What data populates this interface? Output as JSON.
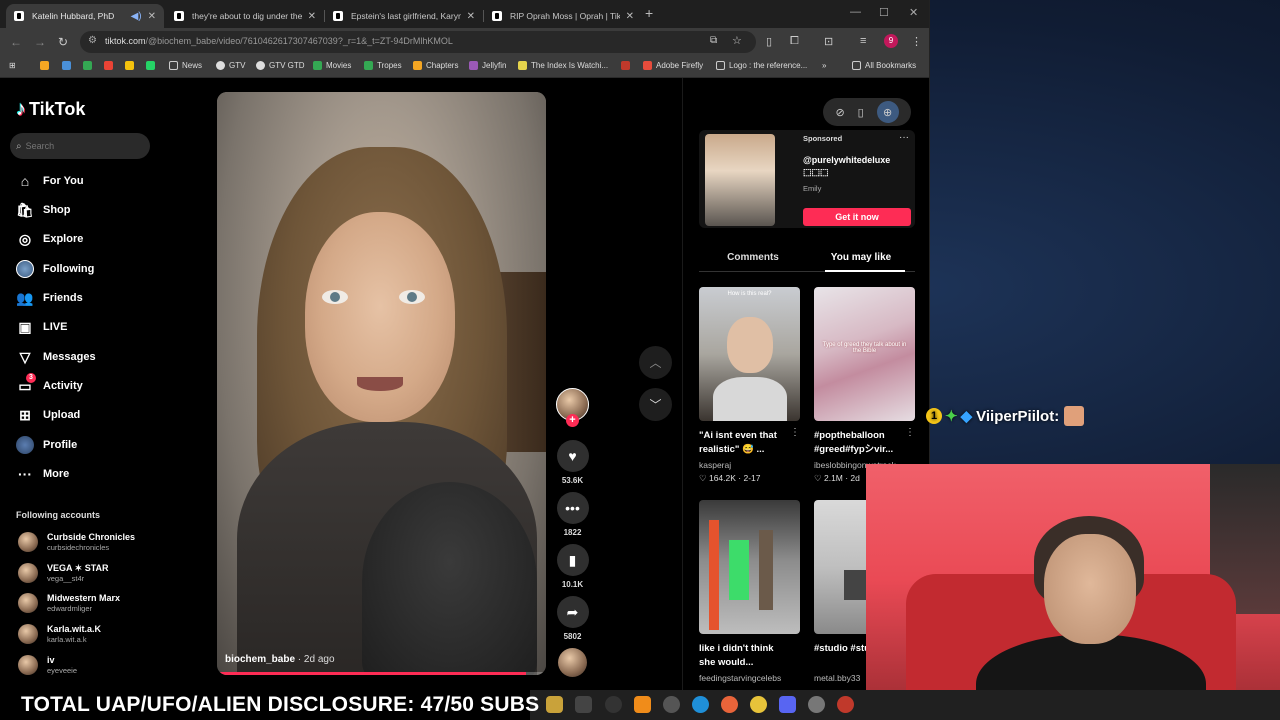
{
  "browser": {
    "tabs": [
      {
        "title": "Katelin Hubbard, PhD",
        "active": true
      },
      {
        "title": "they're about to dig under the p",
        "active": false
      },
      {
        "title": "Epstein's last girlfriend, Karyna",
        "active": false
      },
      {
        "title": "RIP Oprah Moss | Oprah | TikTo",
        "active": false
      }
    ],
    "url_host": "tiktok.com",
    "url_path": "/@biochem_babe/video/7610462617307467039?_r=1&_t=ZT-94DrMlhKMOL",
    "profile_initial": "9",
    "bookmarks": [
      "News",
      "GTV",
      "GTV GTD",
      "Movies",
      "Tropes",
      "Chapters",
      "Jellyfin",
      "The Index Is Watchi...",
      "Adobe Firefly",
      "Logo : the reference..."
    ],
    "all_bookmarks": "All Bookmarks"
  },
  "tiktok": {
    "logo": "TikTok",
    "search_placeholder": "Search",
    "nav": [
      {
        "label": "For You",
        "icon": "home-icon"
      },
      {
        "label": "Shop",
        "icon": "shop-bag-icon"
      },
      {
        "label": "Explore",
        "icon": "compass-icon"
      },
      {
        "label": "Following",
        "icon": "following-avatar-icon"
      },
      {
        "label": "Friends",
        "icon": "friends-icon"
      },
      {
        "label": "LIVE",
        "icon": "live-icon"
      },
      {
        "label": "Messages",
        "icon": "paper-plane-icon"
      },
      {
        "label": "Activity",
        "icon": "activity-icon",
        "badge": "3"
      },
      {
        "label": "Upload",
        "icon": "plus-square-icon"
      },
      {
        "label": "Profile",
        "icon": "profile-avatar-icon"
      },
      {
        "label": "More",
        "icon": "ellipsis-icon"
      }
    ],
    "following_header": "Following accounts",
    "following": [
      {
        "name": "Curbside Chronicles",
        "handle": "curbsidechronicles"
      },
      {
        "name": "VEGA ✶ STAR",
        "handle": "vega__st4r"
      },
      {
        "name": "Midwestern  Marx",
        "handle": "edwardmliger"
      },
      {
        "name": "Karla.wit.a.K",
        "handle": "karla.wit.a.k"
      },
      {
        "name": "iv",
        "handle": "eyeveeie"
      }
    ],
    "video": {
      "username": "biochem_babe",
      "age": "2d ago",
      "progress": 0.94
    },
    "actions": {
      "likes": "53.6K",
      "comments": "1822",
      "saves": "10.1K",
      "shares": "5802"
    },
    "ad": {
      "sponsored": "Sponsored",
      "handle": "@purelywhitedeluxe ⬚⬚⬚",
      "name": "Emily",
      "cta": "Get it now"
    },
    "panel_tabs": [
      "Comments",
      "You may like"
    ],
    "cards": [
      {
        "title": "\"Ai isnt even that realistic\" 😅 ...",
        "author": "kasperaj",
        "stats": "♡ 164.2K · 2-17",
        "thumb_text": "How is this real?"
      },
      {
        "title": "#poptheballoon #greed#fypシvir...",
        "author": "ibeslobbingonwatrock",
        "stats": "♡ 2.1M · 2d",
        "thumb_text": "Type of greed they talk about in the Bible"
      },
      {
        "title": "like i didn't think she would...",
        "author": "feedingstarvingcelebs",
        "stats": "",
        "thumb_text": ""
      },
      {
        "title": "#studio #studioflat",
        "author": "metal.bby33",
        "stats": "",
        "thumb_text": ""
      }
    ]
  },
  "overlay": {
    "chat_badge": "1",
    "chat_user": "ViiperPiilot:",
    "banner": "TOTAL UAP/UFO/ALIEN DISCLOSURE: 47/50 SUBS"
  }
}
